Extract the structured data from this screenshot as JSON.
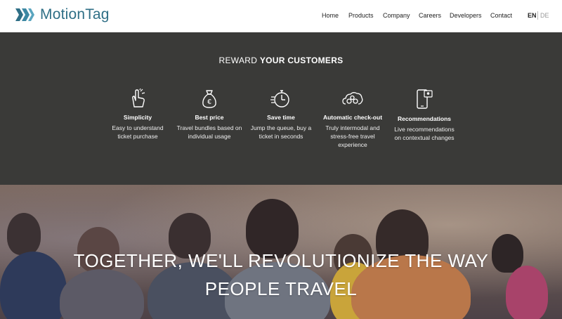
{
  "header": {
    "logo_text": "MotionTag",
    "nav": [
      "Home",
      "Products",
      "Company",
      "Careers",
      "Developers",
      "Contact"
    ],
    "lang": {
      "active": "EN",
      "other": "DE"
    }
  },
  "rewards": {
    "title_light": "REWARD",
    "title_bold": "YOUR CUSTOMERS",
    "features": [
      {
        "icon": "hand-pointer-icon",
        "name": "Simplicity",
        "desc_line1": "Easy to understand",
        "desc_line2": "ticket purchase",
        "desc_line3": ""
      },
      {
        "icon": "money-bag-icon",
        "name": "Best price",
        "desc_line1": "Travel bundles based on",
        "desc_line2": "individual usage",
        "desc_line3": ""
      },
      {
        "icon": "stopwatch-icon",
        "name": "Save time",
        "desc_line1": "Jump the queue, buy a",
        "desc_line2": "ticket in seconds",
        "desc_line3": ""
      },
      {
        "icon": "gears-cloud-icon",
        "name": "Automatic check-out",
        "desc_line1": "Truly intermodal and",
        "desc_line2": "stress-free travel",
        "desc_line3": "experience"
      },
      {
        "icon": "mobile-notification-icon",
        "name": "Recommendations",
        "desc_line1": "Live recommendations",
        "desc_line2": "on contextual changes",
        "desc_line3": ""
      }
    ]
  },
  "hero": {
    "line1": "TOGETHER, WE'LL REVOLUTIONIZE THE WAY",
    "line2": "PEOPLE TRAVEL"
  },
  "colors": {
    "brand": "#2f6f86",
    "dark_band": "#3a3a38"
  }
}
